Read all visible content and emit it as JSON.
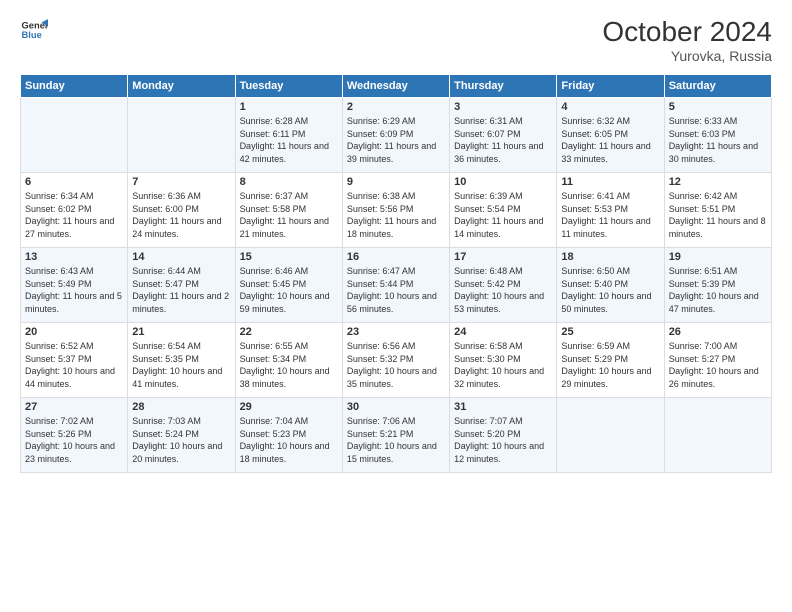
{
  "header": {
    "logo_line1": "General",
    "logo_line2": "Blue",
    "title": "October 2024",
    "subtitle": "Yurovka, Russia"
  },
  "weekdays": [
    "Sunday",
    "Monday",
    "Tuesday",
    "Wednesday",
    "Thursday",
    "Friday",
    "Saturday"
  ],
  "weeks": [
    [
      {
        "day": "",
        "info": ""
      },
      {
        "day": "",
        "info": ""
      },
      {
        "day": "1",
        "info": "Sunrise: 6:28 AM\nSunset: 6:11 PM\nDaylight: 11 hours and 42 minutes."
      },
      {
        "day": "2",
        "info": "Sunrise: 6:29 AM\nSunset: 6:09 PM\nDaylight: 11 hours and 39 minutes."
      },
      {
        "day": "3",
        "info": "Sunrise: 6:31 AM\nSunset: 6:07 PM\nDaylight: 11 hours and 36 minutes."
      },
      {
        "day": "4",
        "info": "Sunrise: 6:32 AM\nSunset: 6:05 PM\nDaylight: 11 hours and 33 minutes."
      },
      {
        "day": "5",
        "info": "Sunrise: 6:33 AM\nSunset: 6:03 PM\nDaylight: 11 hours and 30 minutes."
      }
    ],
    [
      {
        "day": "6",
        "info": "Sunrise: 6:34 AM\nSunset: 6:02 PM\nDaylight: 11 hours and 27 minutes."
      },
      {
        "day": "7",
        "info": "Sunrise: 6:36 AM\nSunset: 6:00 PM\nDaylight: 11 hours and 24 minutes."
      },
      {
        "day": "8",
        "info": "Sunrise: 6:37 AM\nSunset: 5:58 PM\nDaylight: 11 hours and 21 minutes."
      },
      {
        "day": "9",
        "info": "Sunrise: 6:38 AM\nSunset: 5:56 PM\nDaylight: 11 hours and 18 minutes."
      },
      {
        "day": "10",
        "info": "Sunrise: 6:39 AM\nSunset: 5:54 PM\nDaylight: 11 hours and 14 minutes."
      },
      {
        "day": "11",
        "info": "Sunrise: 6:41 AM\nSunset: 5:53 PM\nDaylight: 11 hours and 11 minutes."
      },
      {
        "day": "12",
        "info": "Sunrise: 6:42 AM\nSunset: 5:51 PM\nDaylight: 11 hours and 8 minutes."
      }
    ],
    [
      {
        "day": "13",
        "info": "Sunrise: 6:43 AM\nSunset: 5:49 PM\nDaylight: 11 hours and 5 minutes."
      },
      {
        "day": "14",
        "info": "Sunrise: 6:44 AM\nSunset: 5:47 PM\nDaylight: 11 hours and 2 minutes."
      },
      {
        "day": "15",
        "info": "Sunrise: 6:46 AM\nSunset: 5:45 PM\nDaylight: 10 hours and 59 minutes."
      },
      {
        "day": "16",
        "info": "Sunrise: 6:47 AM\nSunset: 5:44 PM\nDaylight: 10 hours and 56 minutes."
      },
      {
        "day": "17",
        "info": "Sunrise: 6:48 AM\nSunset: 5:42 PM\nDaylight: 10 hours and 53 minutes."
      },
      {
        "day": "18",
        "info": "Sunrise: 6:50 AM\nSunset: 5:40 PM\nDaylight: 10 hours and 50 minutes."
      },
      {
        "day": "19",
        "info": "Sunrise: 6:51 AM\nSunset: 5:39 PM\nDaylight: 10 hours and 47 minutes."
      }
    ],
    [
      {
        "day": "20",
        "info": "Sunrise: 6:52 AM\nSunset: 5:37 PM\nDaylight: 10 hours and 44 minutes."
      },
      {
        "day": "21",
        "info": "Sunrise: 6:54 AM\nSunset: 5:35 PM\nDaylight: 10 hours and 41 minutes."
      },
      {
        "day": "22",
        "info": "Sunrise: 6:55 AM\nSunset: 5:34 PM\nDaylight: 10 hours and 38 minutes."
      },
      {
        "day": "23",
        "info": "Sunrise: 6:56 AM\nSunset: 5:32 PM\nDaylight: 10 hours and 35 minutes."
      },
      {
        "day": "24",
        "info": "Sunrise: 6:58 AM\nSunset: 5:30 PM\nDaylight: 10 hours and 32 minutes."
      },
      {
        "day": "25",
        "info": "Sunrise: 6:59 AM\nSunset: 5:29 PM\nDaylight: 10 hours and 29 minutes."
      },
      {
        "day": "26",
        "info": "Sunrise: 7:00 AM\nSunset: 5:27 PM\nDaylight: 10 hours and 26 minutes."
      }
    ],
    [
      {
        "day": "27",
        "info": "Sunrise: 7:02 AM\nSunset: 5:26 PM\nDaylight: 10 hours and 23 minutes."
      },
      {
        "day": "28",
        "info": "Sunrise: 7:03 AM\nSunset: 5:24 PM\nDaylight: 10 hours and 20 minutes."
      },
      {
        "day": "29",
        "info": "Sunrise: 7:04 AM\nSunset: 5:23 PM\nDaylight: 10 hours and 18 minutes."
      },
      {
        "day": "30",
        "info": "Sunrise: 7:06 AM\nSunset: 5:21 PM\nDaylight: 10 hours and 15 minutes."
      },
      {
        "day": "31",
        "info": "Sunrise: 7:07 AM\nSunset: 5:20 PM\nDaylight: 10 hours and 12 minutes."
      },
      {
        "day": "",
        "info": ""
      },
      {
        "day": "",
        "info": ""
      }
    ]
  ]
}
